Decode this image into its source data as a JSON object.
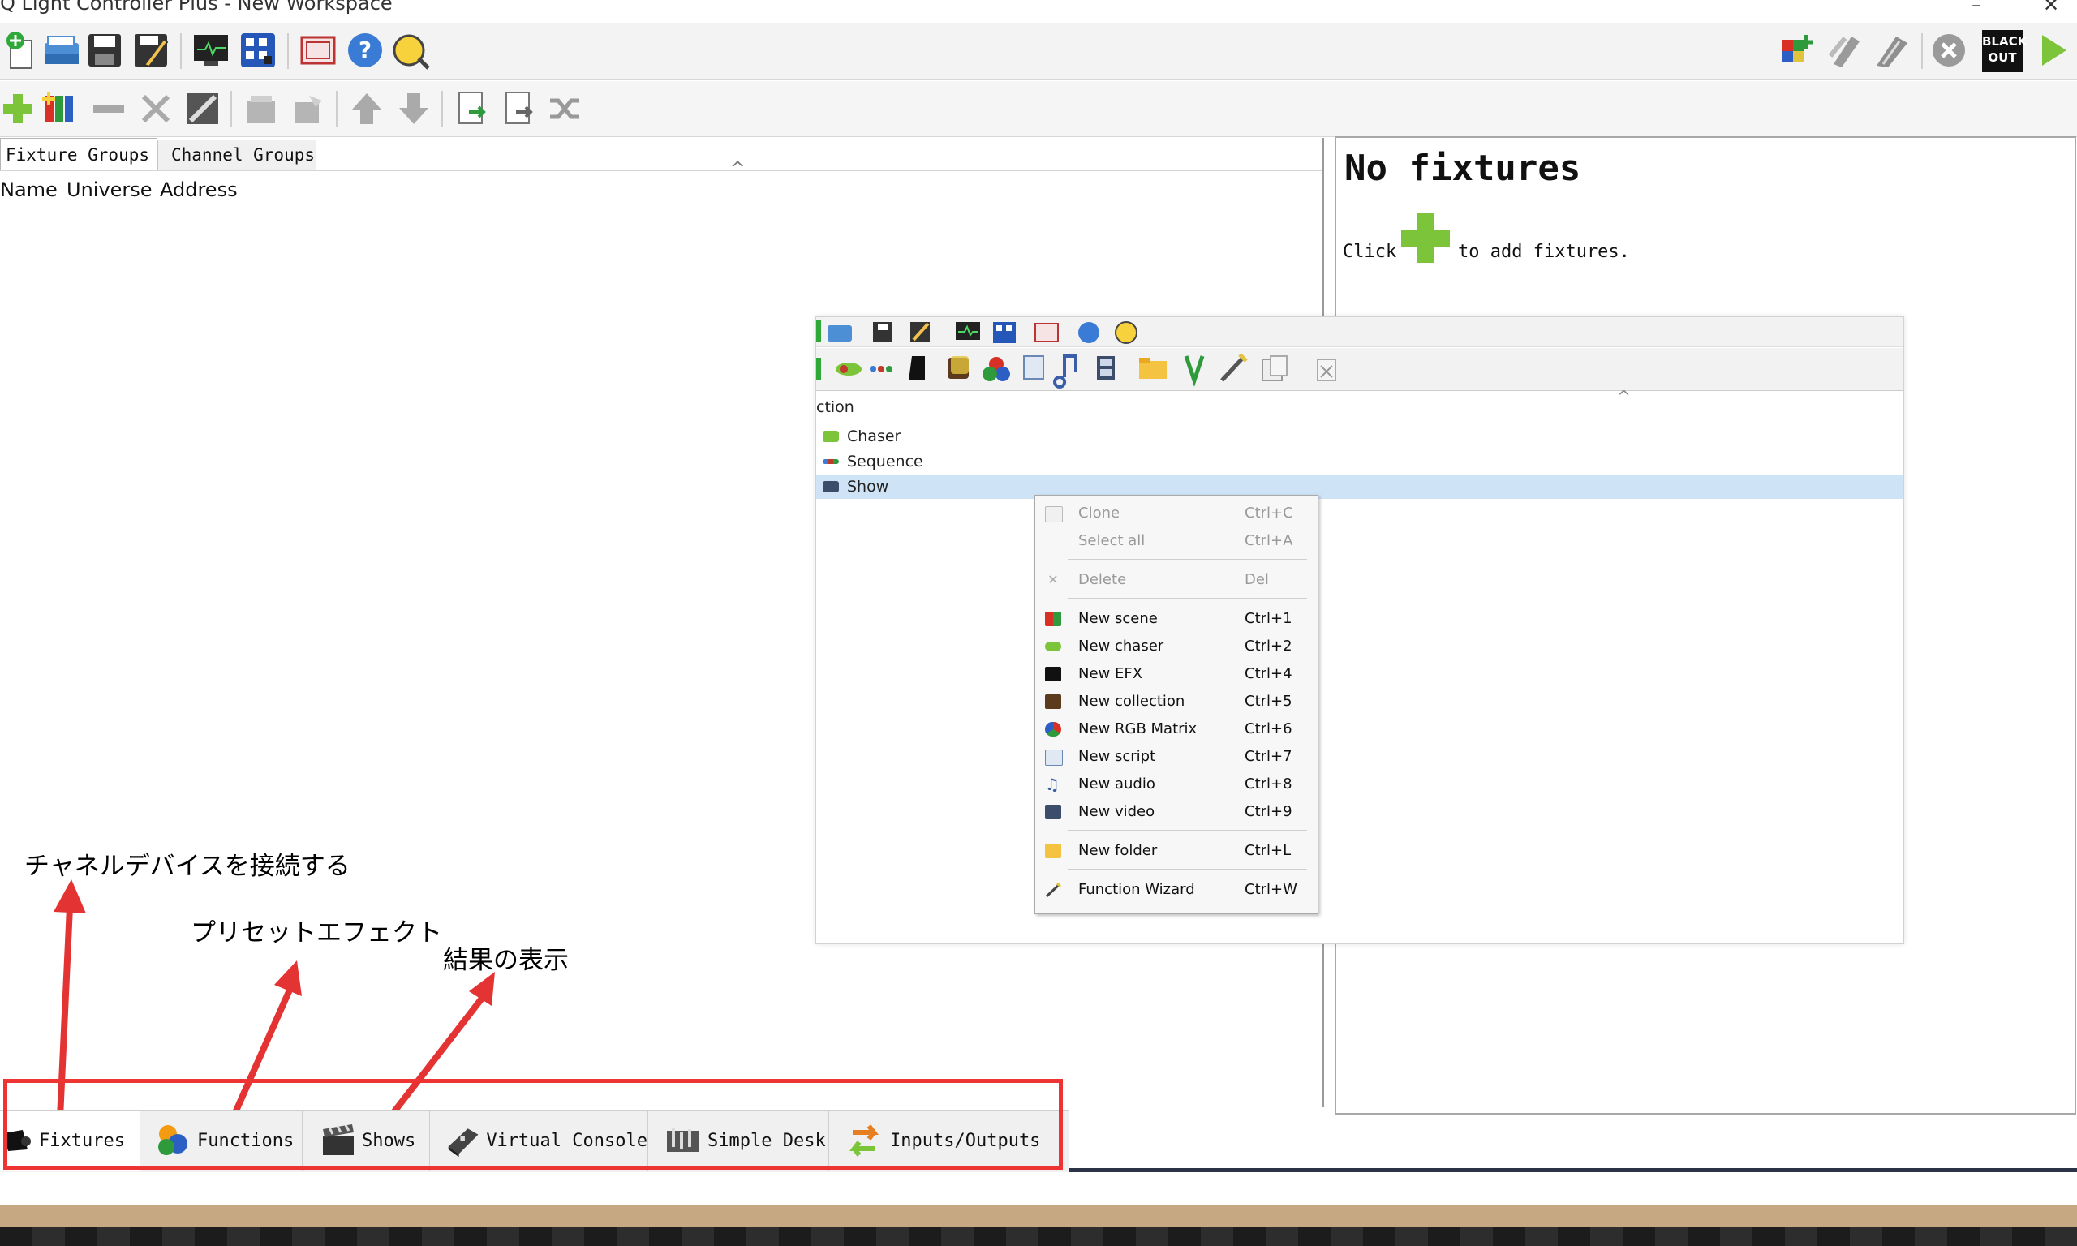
{
  "window": {
    "title": "Q Light Controller Plus - New Workspace",
    "minimize_glyph": "–",
    "close_glyph": "✕"
  },
  "toolbar_main": {
    "icons": [
      "new-workspace-icon",
      "open-icon",
      "save-icon",
      "save-as-icon",
      "monitor-icon",
      "address-tool-icon",
      "fullscreen-icon",
      "help-icon",
      "about-icon"
    ],
    "right_icons": [
      "dmx-dump-icon",
      "live-edit-icon",
      "operate-mode-icon",
      "stop-all-icon",
      "blackout-icon",
      "start-icon"
    ],
    "blackout_label_1": "BLACK",
    "blackout_label_2": "OUT"
  },
  "toolbar_fixtures": {
    "icons": [
      "add-fixture-icon",
      "add-rgb-panel-icon",
      "remove-fixture-icon",
      "configure-fixture-icon",
      "fixture-wizard-icon",
      "group-icon",
      "ungroup-icon",
      "move-up-icon",
      "move-down-icon",
      "import-icon",
      "export-icon",
      "remap-icon"
    ]
  },
  "left_pane": {
    "tabs": [
      "Fixture Groups",
      "Channel Groups"
    ],
    "columns": [
      "Name",
      "Universe",
      "Address"
    ],
    "collapse_glyph": "^"
  },
  "right_pane": {
    "title": "No fixtures",
    "hint_prefix": "Click",
    "hint_suffix": "to add fixtures."
  },
  "functions_overlay": {
    "header": "ction",
    "collapse_glyph": "^",
    "rows": [
      {
        "label": "Chaser",
        "icon": "chaser-icon"
      },
      {
        "label": "Sequence",
        "icon": "sequence-icon"
      },
      {
        "label": "Show",
        "icon": "show-icon"
      }
    ]
  },
  "context_menu": {
    "items": [
      {
        "label": "Clone",
        "shortcut": "Ctrl+C",
        "icon": "clone-icon",
        "enabled": false
      },
      {
        "label": "Select all",
        "shortcut": "Ctrl+A",
        "icon": "",
        "enabled": false
      },
      {
        "label": "Delete",
        "shortcut": "Del",
        "icon": "delete-icon",
        "enabled": false
      },
      {
        "label": "New scene",
        "shortcut": "Ctrl+1",
        "icon": "scene-icon",
        "enabled": true
      },
      {
        "label": "New chaser",
        "shortcut": "Ctrl+2",
        "icon": "chaser-icon",
        "enabled": true
      },
      {
        "label": "New EFX",
        "shortcut": "Ctrl+4",
        "icon": "efx-icon",
        "enabled": true
      },
      {
        "label": "New collection",
        "shortcut": "Ctrl+5",
        "icon": "collection-icon",
        "enabled": true
      },
      {
        "label": "New RGB Matrix",
        "shortcut": "Ctrl+6",
        "icon": "rgb-matrix-icon",
        "enabled": true
      },
      {
        "label": "New script",
        "shortcut": "Ctrl+7",
        "icon": "script-icon",
        "enabled": true
      },
      {
        "label": "New audio",
        "shortcut": "Ctrl+8",
        "icon": "audio-icon",
        "enabled": true
      },
      {
        "label": "New video",
        "shortcut": "Ctrl+9",
        "icon": "video-icon",
        "enabled": true
      },
      {
        "label": "New folder",
        "shortcut": "Ctrl+L",
        "icon": "folder-icon",
        "enabled": true
      },
      {
        "label": "Function Wizard",
        "shortcut": "Ctrl+W",
        "icon": "wizard-icon",
        "enabled": true
      }
    ]
  },
  "annotations": {
    "fixtures_note": "チャネルデバイスを接続する",
    "functions_note": "プリセットエフェクト",
    "shows_note": "結果の表示"
  },
  "bottom_tabs": [
    {
      "label": "Fixtures",
      "icon": "fixtures-icon"
    },
    {
      "label": "Functions",
      "icon": "functions-icon"
    },
    {
      "label": "Shows",
      "icon": "shows-icon"
    },
    {
      "label": "Virtual Console",
      "icon": "virtual-console-icon"
    },
    {
      "label": "Simple Desk",
      "icon": "simple-desk-icon"
    },
    {
      "label": "Inputs/Outputs",
      "icon": "inputs-outputs-icon"
    }
  ],
  "colors": {
    "annotation_red": "#e33333",
    "selection_blue": "#cfe3f7",
    "add_green": "#7cc43a"
  }
}
